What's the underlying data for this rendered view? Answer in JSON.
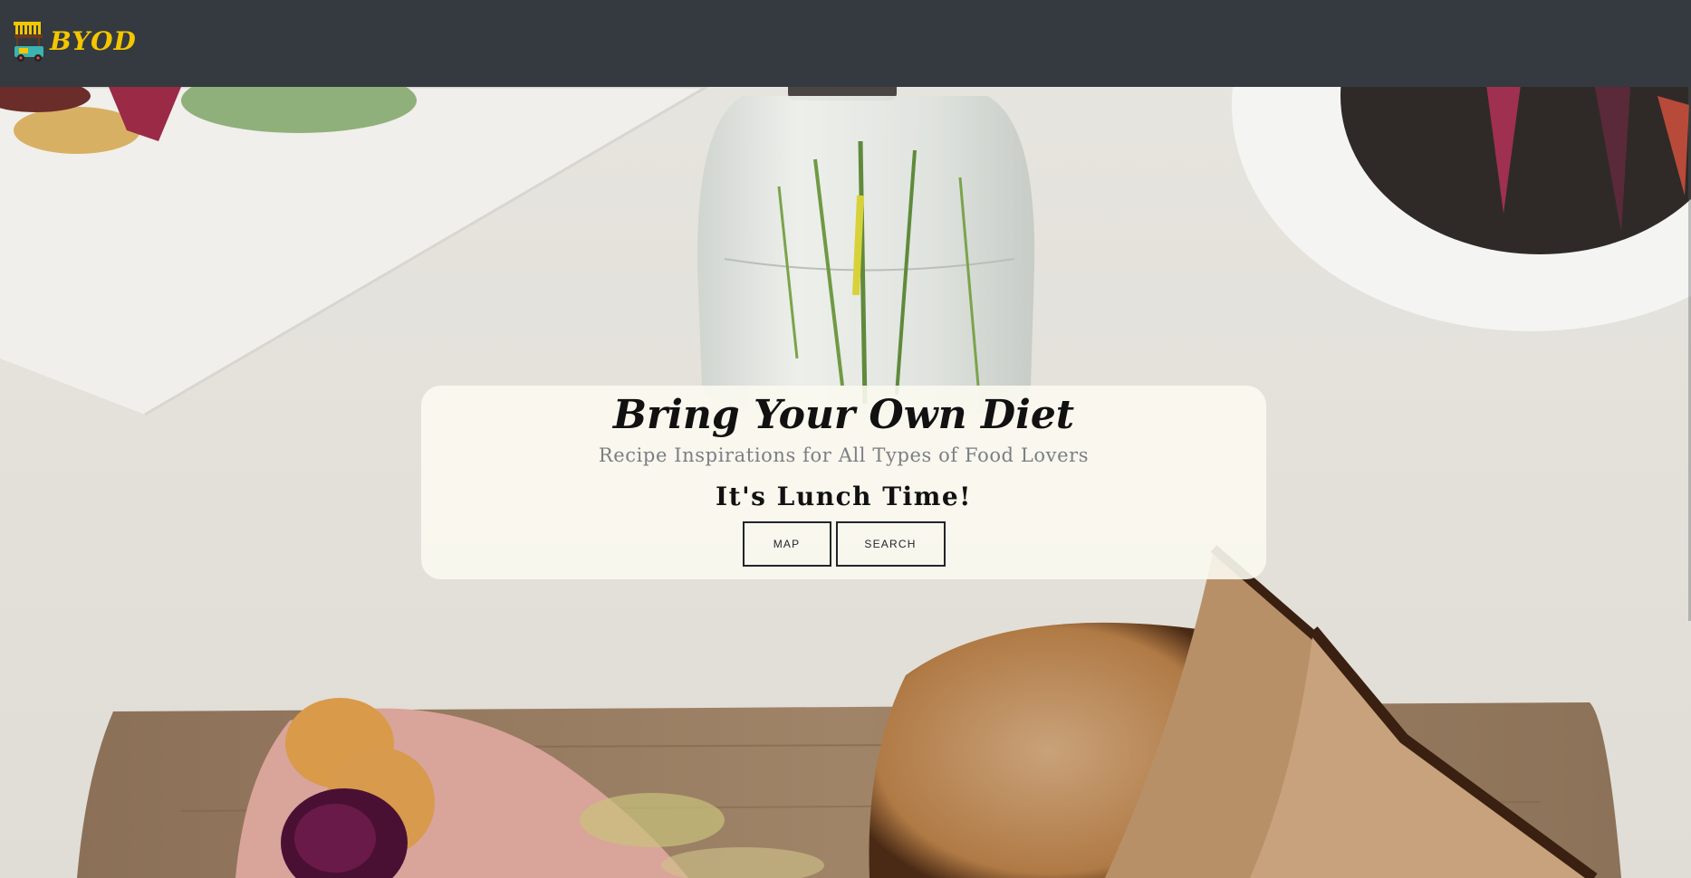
{
  "navbar": {
    "brand_text": "BYOD",
    "brand_icon": "food-cart-icon",
    "background": "#343a40",
    "brand_color": "#f4c600"
  },
  "hero": {
    "title": "Bring Your Own Diet",
    "subtitle": "Recipe Inspirations for All Types of Food Lovers",
    "greeting": "It's Lunch Time!",
    "buttons": {
      "map_label": "MAP",
      "search_label": "SEARCH"
    },
    "background_image": "food-table-photo"
  }
}
